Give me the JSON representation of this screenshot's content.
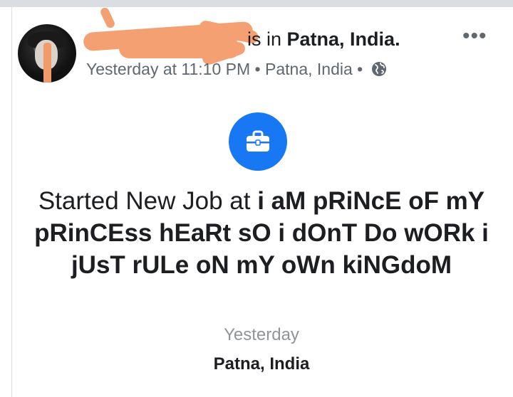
{
  "post": {
    "header": {
      "action_text": " is in ",
      "location": "Patna, India.",
      "time": "Yesterday at 11:10 PM",
      "separator": " • ",
      "place": "Patna, India",
      "privacy_icon": "globe-icon",
      "more_label": "•••"
    },
    "life_event": {
      "icon": "briefcase-icon",
      "headline_prefix": "Started New Job at ",
      "headline_strong": "i aM pRiNcE oF mY pRinCEss hEaRt sO i dOnT Do wORk i jUsT rULe oN mY oWn kiNGdoM",
      "date": "Yesterday",
      "place": "Patna, India"
    },
    "colors": {
      "accent": "#1877f2",
      "secondary_text": "#606770",
      "redaction": "#f4a072"
    }
  }
}
